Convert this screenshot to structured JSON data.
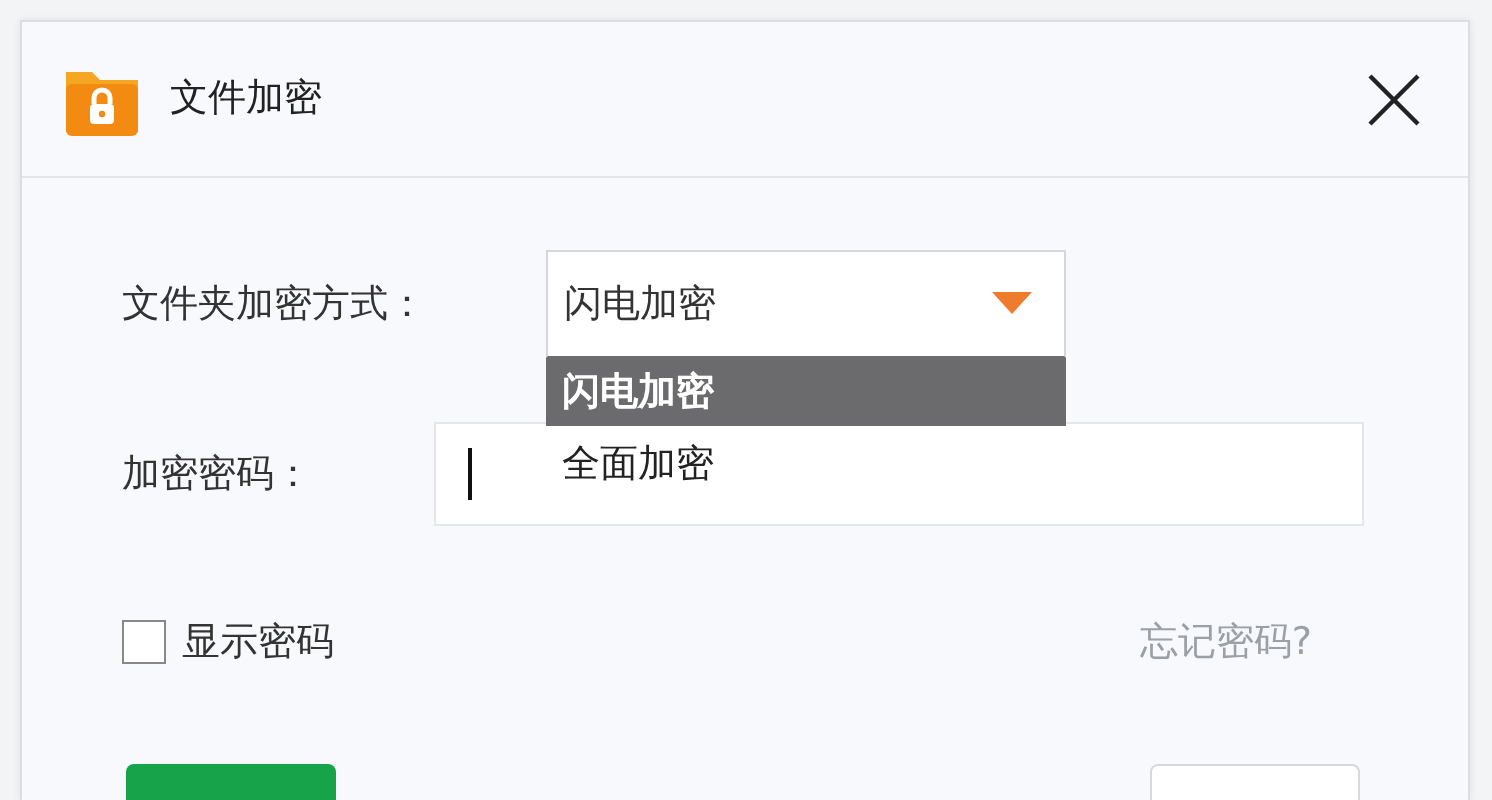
{
  "window": {
    "title": "文件加密"
  },
  "method": {
    "label": "文件夹加密方式：",
    "value": "闪电加密",
    "expanded": true,
    "options": [
      {
        "label": "闪电加密",
        "selected": true
      },
      {
        "label": "全面加密",
        "selected": false
      }
    ]
  },
  "password": {
    "label": "加密密码："
  },
  "show_password": {
    "label": "显示密码",
    "checked": false
  },
  "forgot_link": "忘记密码?",
  "buttons": [
    {
      "kind": "primary"
    },
    {
      "kind": "secondary"
    }
  ]
}
